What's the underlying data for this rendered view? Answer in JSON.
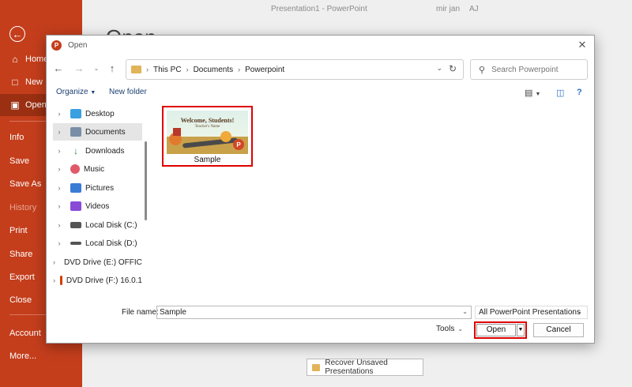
{
  "window": {
    "doc_title": "Presentation1 - PowerPoint",
    "user_name": "mir jan",
    "user_initials": "AJ",
    "open_heading": "Open"
  },
  "backstage": {
    "items": [
      {
        "label": "Home",
        "icon": "home-icon"
      },
      {
        "label": "New",
        "icon": "new-doc-icon"
      },
      {
        "label": "Open",
        "icon": "open-folder-icon"
      },
      {
        "label": "Info"
      },
      {
        "label": "Save"
      },
      {
        "label": "Save As"
      },
      {
        "label": "History"
      },
      {
        "label": "Print"
      },
      {
        "label": "Share"
      },
      {
        "label": "Export"
      },
      {
        "label": "Close"
      },
      {
        "label": "Account"
      },
      {
        "label": "More..."
      }
    ]
  },
  "recover_button": "Recover Unsaved Presentations",
  "dialog": {
    "title": "Open",
    "breadcrumb": [
      "This PC",
      "Documents",
      "Powerpoint"
    ],
    "search_placeholder": "Search Powerpoint",
    "organize": "Organize",
    "new_folder": "New folder",
    "nav_items": [
      {
        "label": "Desktop",
        "icon": "desktop-icon",
        "color": "#3aa0e0"
      },
      {
        "label": "Documents",
        "icon": "documents-icon",
        "color": "#7a8fa6",
        "selected": true
      },
      {
        "label": "Downloads",
        "icon": "download-icon",
        "color": "#2b8a3e"
      },
      {
        "label": "Music",
        "icon": "music-icon",
        "color": "#e05a6a"
      },
      {
        "label": "Pictures",
        "icon": "pictures-icon",
        "color": "#3a7bd5"
      },
      {
        "label": "Videos",
        "icon": "videos-icon",
        "color": "#8a4ad8"
      },
      {
        "label": "Local Disk (C:)",
        "icon": "disk-icon",
        "color": "#555555"
      },
      {
        "label": "Local Disk (D:)",
        "icon": "disk-icon",
        "color": "#555555"
      },
      {
        "label": "DVD Drive (E:) OFFICE",
        "icon": "dvd-icon",
        "color": "#666666"
      },
      {
        "label": "DVD Drive (F:) 16.0.1",
        "icon": "office-icon",
        "color": "#d83b01"
      }
    ],
    "file": {
      "name": "Sample",
      "thumb_title": "Welcome, Students!",
      "thumb_subtitle": "Teacher's Name",
      "thumb_badge": "P"
    },
    "filename_label": "File name:",
    "filename_value": "Sample",
    "filetype": "All PowerPoint Presentations",
    "tools": "Tools",
    "open": "Open",
    "cancel": "Cancel"
  }
}
